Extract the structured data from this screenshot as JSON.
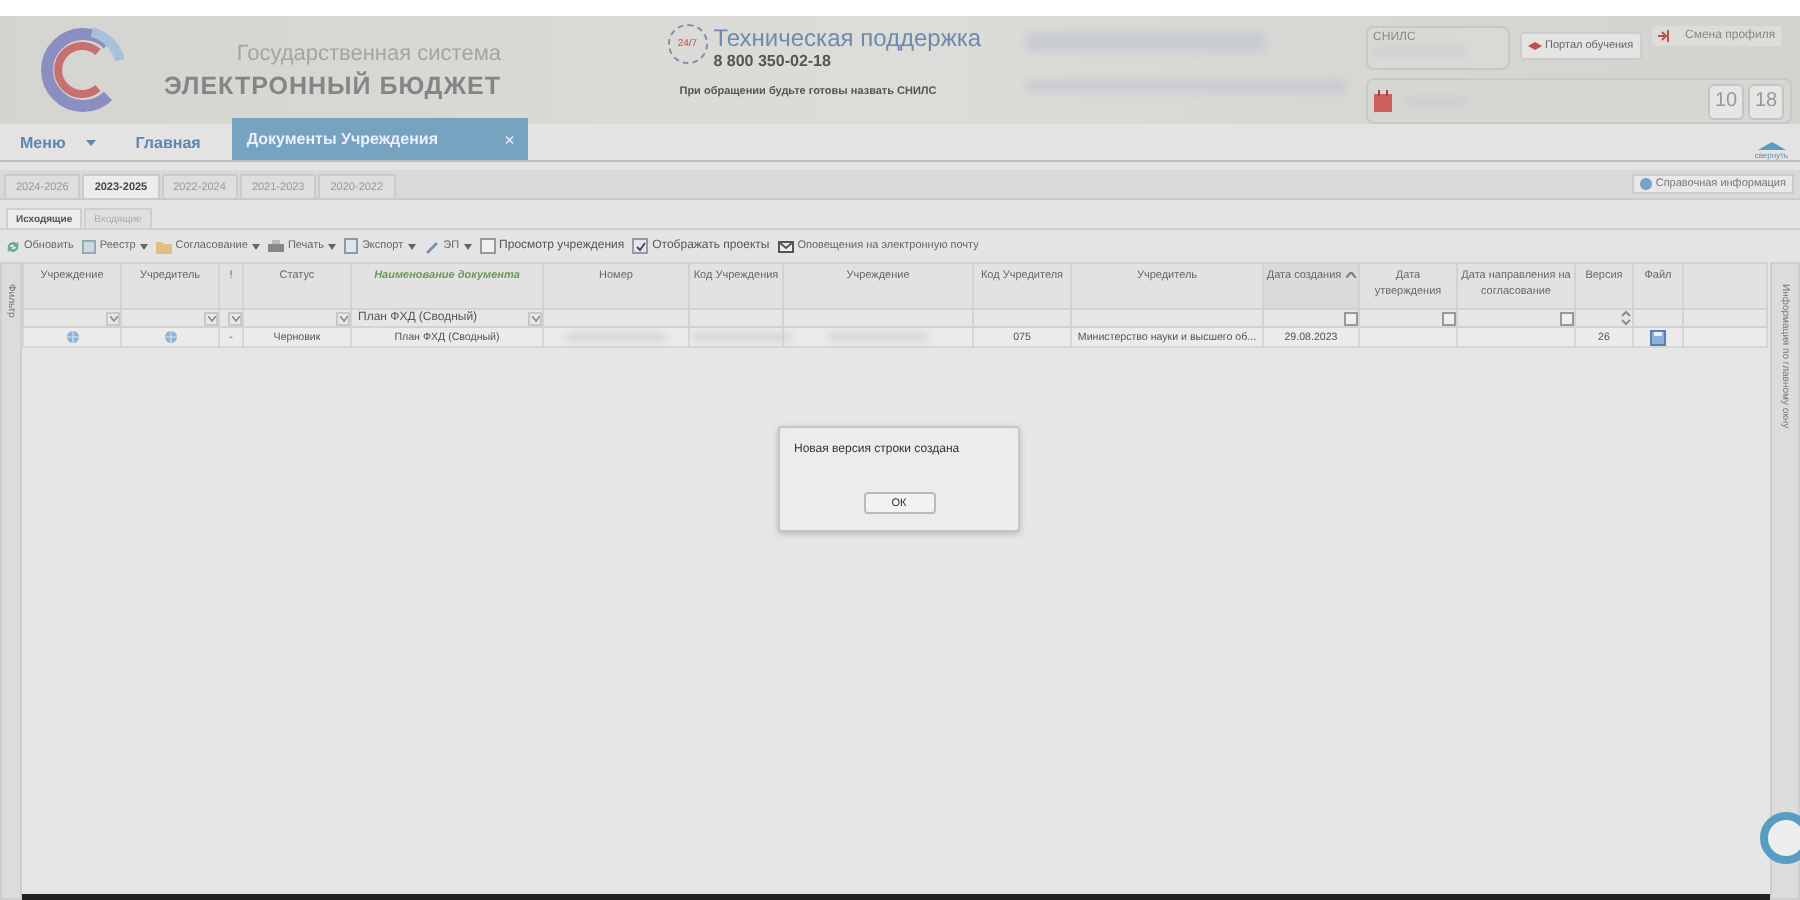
{
  "header": {
    "system_subtitle": "Государственная система",
    "system_title": "ЭЛЕКТРОННЫЙ БЮДЖЕТ",
    "support": {
      "badge": "24/7",
      "title": "Техническая поддержка",
      "phone": "8 800 350-02-18",
      "note": "При обращении будьте готовы назвать СНИЛС"
    },
    "snils_label": "СНИЛС",
    "portal_button": "Портал обучения",
    "profile_button": "Смена профиля",
    "counters": [
      "10",
      "18"
    ]
  },
  "nav": {
    "menu": "Меню",
    "home": "Главная",
    "active_tab": "Документы Учреждения",
    "close": "×",
    "collapse": "свернуть"
  },
  "year_tabs": [
    {
      "label": "2024-2026",
      "selected": false
    },
    {
      "label": "2023-2025",
      "selected": true
    },
    {
      "label": "2022-2024",
      "selected": false
    },
    {
      "label": "2021-2023",
      "selected": false
    },
    {
      "label": "2020-2022",
      "selected": false
    }
  ],
  "reference_button": "Справочная информация",
  "sub_tabs": [
    {
      "label": "Исходящие",
      "selected": true
    },
    {
      "label": "Входящие",
      "selected": false
    }
  ],
  "toolbar": [
    {
      "kind": "button",
      "label": "Обновить",
      "dropdown": false
    },
    {
      "kind": "button",
      "label": "Реестр",
      "dropdown": true
    },
    {
      "kind": "button",
      "label": "Согласование",
      "dropdown": true
    },
    {
      "kind": "button",
      "label": "Печать",
      "dropdown": true
    },
    {
      "kind": "button",
      "label": "Экспорт",
      "dropdown": true
    },
    {
      "kind": "button",
      "label": "ЭП",
      "dropdown": true
    },
    {
      "kind": "checkbox",
      "label": "Просмотр учреждения",
      "checked": false
    },
    {
      "kind": "checkbox",
      "label": "Отображать проекты",
      "checked": true
    },
    {
      "kind": "button",
      "label": "Оповещения на электронную почту",
      "dropdown": false
    }
  ],
  "filter_strip": "Фильтр",
  "info_strip": "Информация по главному окну",
  "table": {
    "columns": [
      {
        "label": "Учреждение",
        "highlighted": false,
        "sorted": false,
        "kind": "select"
      },
      {
        "label": "Учредитель",
        "highlighted": false,
        "sorted": false,
        "kind": "select"
      },
      {
        "label": "!",
        "highlighted": false,
        "sorted": false,
        "kind": "select"
      },
      {
        "label": "Статус",
        "highlighted": false,
        "sorted": false,
        "kind": "select"
      },
      {
        "label": "Наименование документа",
        "highlighted": true,
        "sorted": false,
        "kind": "select",
        "filter_value": "План ФХД (Сводный)"
      },
      {
        "label": "Номер",
        "highlighted": false,
        "sorted": false,
        "kind": "plain"
      },
      {
        "label": "Код Учреждения",
        "highlighted": false,
        "sorted": false,
        "kind": "plain"
      },
      {
        "label": "Учреждение",
        "highlighted": false,
        "sorted": false,
        "kind": "plain"
      },
      {
        "label": "Код Учредителя",
        "highlighted": false,
        "sorted": false,
        "kind": "plain"
      },
      {
        "label": "Учредитель",
        "highlighted": false,
        "sorted": false,
        "kind": "plain"
      },
      {
        "label": "Дата создания",
        "highlighted": false,
        "sorted": true,
        "kind": "date"
      },
      {
        "label": "Дата утверждения",
        "highlighted": false,
        "sorted": false,
        "kind": "date"
      },
      {
        "label": "Дата направления на согласование",
        "highlighted": false,
        "sorted": false,
        "kind": "date"
      },
      {
        "label": "Версия",
        "highlighted": false,
        "sorted": false,
        "kind": "spin"
      },
      {
        "label": "Файл",
        "highlighted": false,
        "sorted": false,
        "kind": "plain"
      }
    ],
    "rows": [
      {
        "cells": [
          {
            "kind": "globe"
          },
          {
            "kind": "globe"
          },
          {
            "kind": "text",
            "text": "-"
          },
          {
            "kind": "text",
            "text": "Черновик"
          },
          {
            "kind": "text",
            "text": "План ФХД (Сводный)"
          },
          {
            "kind": "blurred"
          },
          {
            "kind": "blurred"
          },
          {
            "kind": "blurred"
          },
          {
            "kind": "text",
            "text": "075"
          },
          {
            "kind": "text",
            "text": "Министерство науки и высшего об..."
          },
          {
            "kind": "text",
            "text": "29.08.2023"
          },
          {
            "kind": "empty"
          },
          {
            "kind": "empty"
          },
          {
            "kind": "text",
            "text": "26"
          },
          {
            "kind": "file"
          }
        ]
      }
    ]
  },
  "dialog": {
    "message": "Новая версия строки создана",
    "button": "ОК"
  }
}
